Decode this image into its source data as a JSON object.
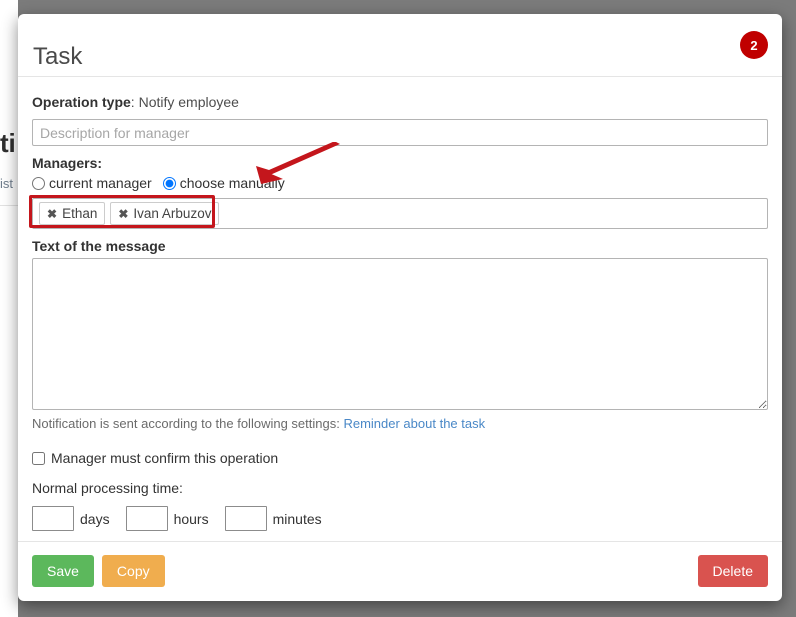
{
  "backdrop": {
    "heading_fragment": "ti",
    "subtext_fragment": "ist"
  },
  "modal": {
    "title": "Task",
    "badge_count": "2",
    "colors": {
      "badge": "#c00000",
      "annotation": "#c4161c",
      "link": "#4a88c7",
      "save": "#5cb85c",
      "copy": "#f0ad4e",
      "delete": "#d9534f",
      "radio_selected": "#0a7cdb"
    },
    "form": {
      "operation_type_label": "Operation type",
      "operation_type_separator": ": ",
      "operation_type_value": "Notify employee",
      "description": {
        "value": "",
        "placeholder": "Description for manager"
      },
      "managers_label": "Managers:",
      "manager_options": [
        {
          "label": "current manager",
          "selected": false
        },
        {
          "label": "choose manually",
          "selected": true
        }
      ],
      "selected_managers": [
        {
          "name": "Ethan",
          "remove_glyph": "✖"
        },
        {
          "name": "Ivan Arbuzov",
          "remove_glyph": "✖"
        }
      ],
      "message_label": "Text of the message",
      "message": {
        "value": "",
        "placeholder": ""
      },
      "notification_note": "Notification is sent according to the following settings:",
      "notification_link": "Reminder about the task",
      "confirm_checkbox": {
        "label": "Manager must confirm this operation",
        "checked": false
      },
      "processing_time_label": "Normal processing time:",
      "processing_time": [
        {
          "value": "",
          "unit": "days"
        },
        {
          "value": "",
          "unit": "hours"
        },
        {
          "value": "",
          "unit": "minutes"
        }
      ]
    },
    "footer": {
      "save_label": "Save",
      "copy_label": "Copy",
      "delete_label": "Delete"
    }
  }
}
